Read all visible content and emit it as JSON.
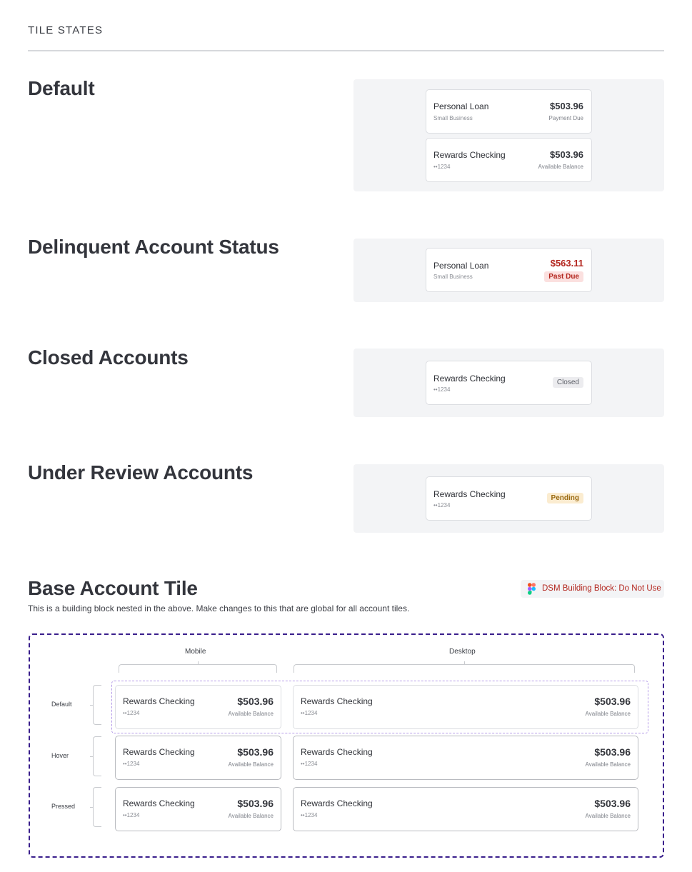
{
  "header": {
    "title": "TILE STATES"
  },
  "sections": {
    "default": {
      "title": "Default",
      "tiles": [
        {
          "name": "Personal Loan",
          "sub": "Small Business",
          "amount": "$503.96",
          "meta": "Payment Due"
        },
        {
          "name": "Rewards Checking",
          "sub": "••1234",
          "amount": "$503.96",
          "meta": "Available Balance"
        }
      ]
    },
    "delinquent": {
      "title": "Delinquent Account Status",
      "tile": {
        "name": "Personal Loan",
        "sub": "Small Business",
        "amount": "$563.11",
        "badge": "Past Due"
      }
    },
    "closed": {
      "title": "Closed Accounts",
      "tile": {
        "name": "Rewards Checking",
        "sub": "••1234",
        "badge": "Closed"
      }
    },
    "review": {
      "title": "Under Review Accounts",
      "tile": {
        "name": "Rewards Checking",
        "sub": "••1234",
        "badge": "Pending"
      }
    }
  },
  "base": {
    "title": "Base Account Tile",
    "description": "This is a building block nested in the above. Make changes to this that are global for all account tiles.",
    "dsm_label": "DSM Building Block: Do Not Use",
    "columns": [
      "Mobile",
      "Desktop"
    ],
    "rows": [
      "Default",
      "Hover",
      "Pressed"
    ],
    "tile": {
      "name": "Rewards Checking",
      "sub": "••1234",
      "amount": "$503.96",
      "meta": "Available Balance"
    }
  },
  "colors": {
    "accent_red": "#b3261e",
    "frame_purple": "#3a1f8c",
    "stage_bg": "#f3f4f6"
  },
  "icons": {
    "dsm": "figma-icon"
  }
}
